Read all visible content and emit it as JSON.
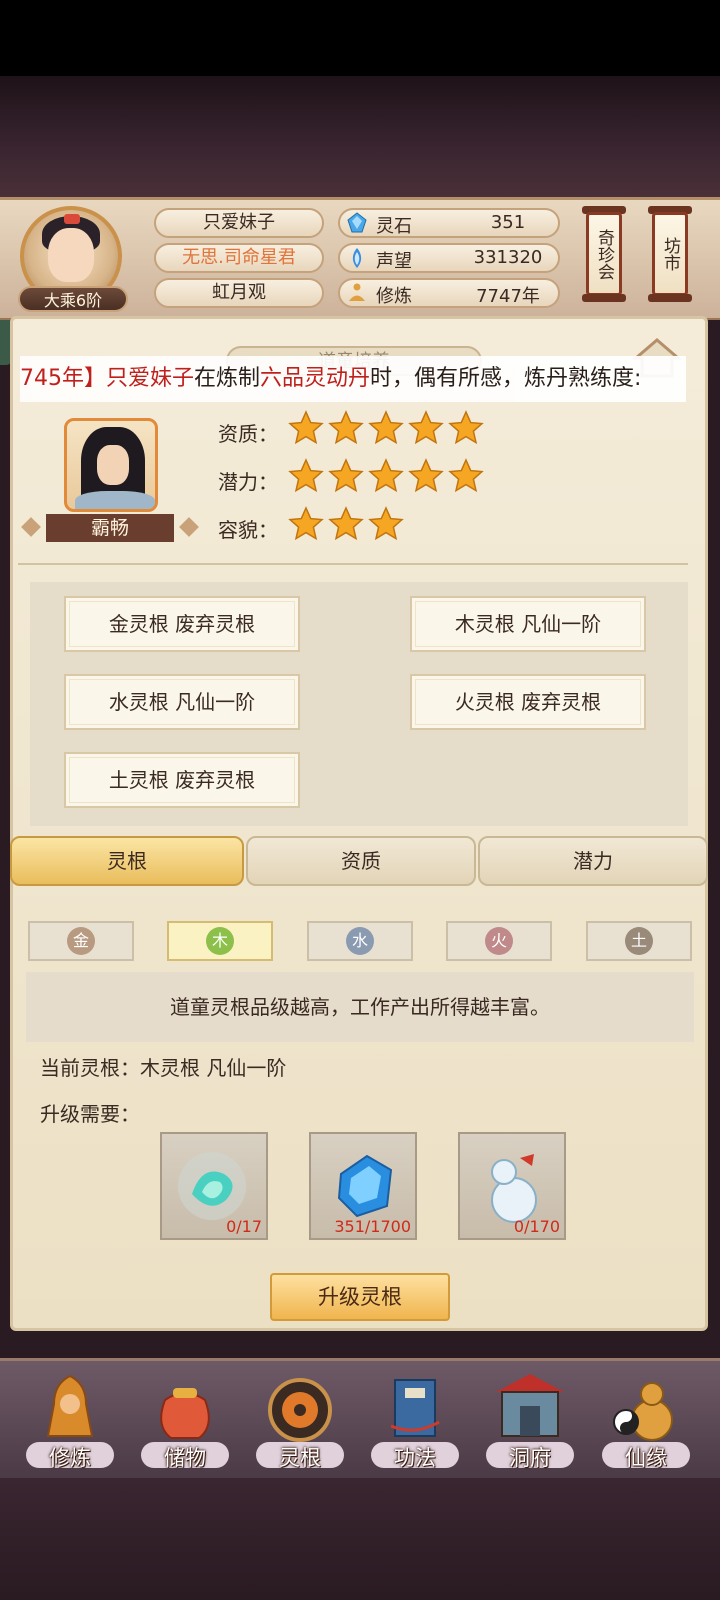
{
  "player": {
    "rank": "大乘6阶",
    "name": "只爱妹子",
    "title": "无思.司命星君",
    "sect": "虹月观"
  },
  "stats": [
    {
      "icon": "spirit-stone-icon",
      "label": "灵石",
      "value": "351"
    },
    {
      "icon": "prestige-icon",
      "label": "声望",
      "value": "331320"
    },
    {
      "icon": "cultivation-icon",
      "label": "修炼",
      "value": "7747年"
    }
  ],
  "side_buttons": {
    "treasure": "奇珍会",
    "market": "坊市"
  },
  "panel": {
    "title": "道童培养"
  },
  "ticker": {
    "p1": "745年】",
    "p2": "只爱妹子",
    "p3": "在炼制",
    "p4": "六品灵动丹",
    "p5": "时，偶有所感，炼丹熟练度:"
  },
  "disciple": {
    "name": "霸畅",
    "attributes": [
      {
        "label": "资质：",
        "stars": 5
      },
      {
        "label": "潜力：",
        "stars": 5
      },
      {
        "label": "容貌：",
        "stars": 3
      }
    ]
  },
  "roots": [
    "金灵根 废弃灵根",
    "木灵根 凡仙一阶",
    "水灵根 凡仙一阶",
    "火灵根 废弃灵根",
    "土灵根 废弃灵根"
  ],
  "tabs": [
    "灵根",
    "资质",
    "潜力"
  ],
  "elements": [
    {
      "label": "金",
      "color": "#b89a80"
    },
    {
      "label": "木",
      "color": "#8cc04a"
    },
    {
      "label": "水",
      "color": "#8a9ab0"
    },
    {
      "label": "火",
      "color": "#c08a8a"
    },
    {
      "label": "土",
      "color": "#9a8a7a"
    }
  ],
  "description": "道童灵根品级越高，工作产出所得越丰富。",
  "current_root": "当前灵根：木灵根 凡仙一阶",
  "upgrade_need_label": "升级需要：",
  "materials": [
    {
      "icon": "jade-spirit-icon",
      "count": "0/17"
    },
    {
      "icon": "spirit-crystal-icon",
      "count": "351/1700"
    },
    {
      "icon": "gourd-potion-icon",
      "count": "0/170"
    }
  ],
  "upgrade_button": "升级灵根",
  "nav": [
    "修炼",
    "储物",
    "灵根",
    "功法",
    "洞府",
    "仙缘"
  ]
}
